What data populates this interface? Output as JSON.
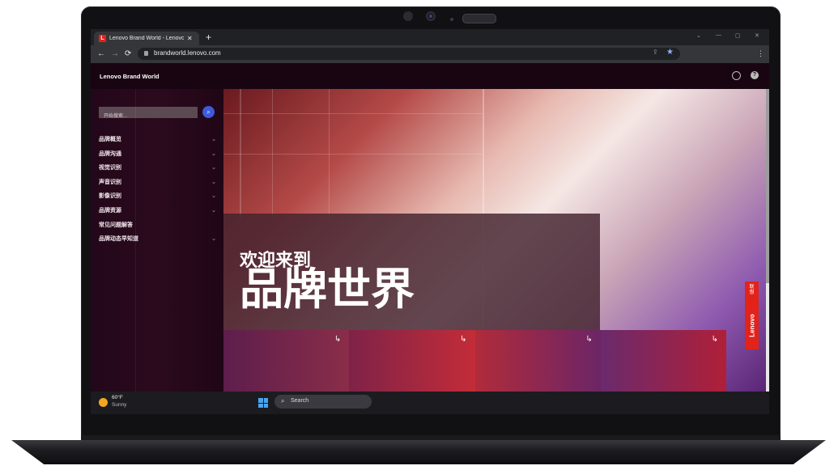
{
  "browser": {
    "tab_title": "Lenovo Brand World - Lenovo B",
    "favicon_letter": "L",
    "new_tab": "+",
    "url": "brandworld.lenovo.com"
  },
  "site": {
    "brand": "Lenovo Brand World",
    "search_placeholder": "开始搜索...",
    "menu": [
      {
        "label": "品牌概览",
        "has_children": true
      },
      {
        "label": "品牌沟通",
        "has_children": true
      },
      {
        "label": "视觉识别",
        "has_children": true
      },
      {
        "label": "声音识别",
        "has_children": true
      },
      {
        "label": "影像识别",
        "has_children": true
      },
      {
        "label": "品牌资源",
        "has_children": true
      },
      {
        "label": "常见问题解答",
        "has_children": false
      },
      {
        "label": "品牌动态早知道",
        "has_children": true
      }
    ],
    "hero": {
      "welcome": "欢迎来到",
      "headline": "品牌世界"
    },
    "logo_text": "Lenovo",
    "logo_cn": "联想"
  },
  "taskbar": {
    "temperature": "60°F",
    "condition": "Sunny",
    "search_label": "Search"
  },
  "colors": {
    "lenovo_red": "#e2231a",
    "search_button": "#3d5bd9"
  }
}
